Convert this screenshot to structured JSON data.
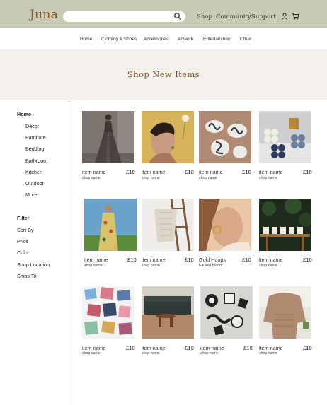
{
  "header": {
    "logo": "Juna",
    "search_placeholder": "",
    "nav": [
      "Shop",
      "Community",
      "Support"
    ],
    "bg_color": "#c9cbb6",
    "accent_color": "#8a5a1e"
  },
  "categories": [
    "Home",
    "Clothing & Shoes",
    "Accessories",
    "Artwork",
    "Entertainment",
    "Other"
  ],
  "hero": {
    "title": "Shop New Items"
  },
  "sidebar": {
    "section_title": "Home",
    "items": [
      "Décor",
      "Furniture",
      "Bedding",
      "Bathroom",
      "Kitchen",
      "Outdoor",
      "More"
    ],
    "filter_title": "Filter",
    "filters": [
      "Sort By",
      "Price",
      "Color",
      "Shop Location",
      "Ships To"
    ]
  },
  "products": [
    {
      "name": "item name",
      "shop": "shop name",
      "price": "£10",
      "image": "woman-in-gown"
    },
    {
      "name": "item name",
      "shop": "shop name",
      "price": "£10",
      "image": "woman-with-earring"
    },
    {
      "name": "item name",
      "shop": "shop name",
      "price": "£10",
      "image": "snake-stones"
    },
    {
      "name": "item name",
      "shop": "shop name",
      "price": "£10",
      "image": "bubble-candles"
    },
    {
      "name": "item name",
      "shop": "shop name",
      "price": "£10",
      "image": "floral-dress"
    },
    {
      "name": "item name",
      "shop": "shop name",
      "price": "£10",
      "image": "knit-blanket-ladder"
    },
    {
      "name": "Gold Hoops",
      "shop": "Elk and Bloom",
      "price": "£10",
      "image": "gold-hoop-earrings"
    },
    {
      "name": "item name",
      "shop": "shop name",
      "price": "£10",
      "image": "candles-on-shelf"
    },
    {
      "name": "item name",
      "shop": "shop name",
      "price": "£10",
      "image": "photo-collage"
    },
    {
      "name": "item name",
      "shop": "shop name",
      "price": "£10",
      "image": "living-room-table"
    },
    {
      "name": "item name",
      "shop": "shop name",
      "price": "£10",
      "image": "checkered-shapes"
    },
    {
      "name": "item name",
      "shop": "shop name",
      "price": "£10",
      "image": "knit-sweater"
    }
  ]
}
